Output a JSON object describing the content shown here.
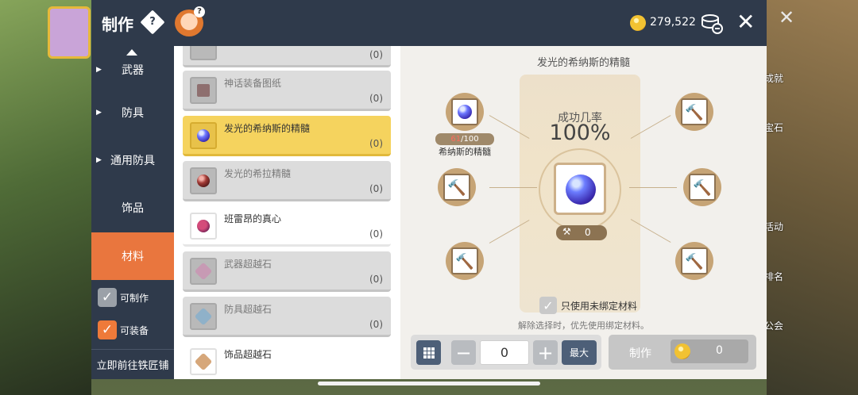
{
  "header": {
    "title": "制作",
    "help_icon": "diamond-question-icon",
    "mascot_icon": "fox-mascot-icon",
    "currency_icon": "meso-coin-icon",
    "currency_amount": "279,522",
    "recipe_icon": "recipe-stack-icon",
    "close_icon": "close-icon"
  },
  "background": {
    "right_labels": [
      "成就",
      "宝石",
      "活动",
      "排名",
      "公会"
    ]
  },
  "nav": {
    "items": [
      {
        "label": "武器",
        "arrow": "▶"
      },
      {
        "label": "防具",
        "arrow": "▶"
      },
      {
        "label": "通用防具",
        "arrow": "▶"
      },
      {
        "label": "饰品",
        "arrow": ""
      },
      {
        "label": "材料",
        "arrow": ""
      }
    ],
    "active_index": 4,
    "filters": [
      {
        "label": "可制作",
        "checked": true,
        "color": "#9ba1a8"
      },
      {
        "label": "可装备",
        "checked": true,
        "color": "#ee7a3a"
      }
    ],
    "goto_label": "立即前往铁匠铺"
  },
  "list": {
    "items": [
      {
        "name": "",
        "count": "(0)"
      },
      {
        "name": "神话装备图纸",
        "count": "(0)"
      },
      {
        "name": "发光的希纳斯的精髓",
        "count": "(0)"
      },
      {
        "name": "发光的希拉精髓",
        "count": "(0)"
      },
      {
        "name": "班雷昂的真心",
        "count": "(0)"
      },
      {
        "name": "武器超越石",
        "count": "(0)"
      },
      {
        "name": "防具超越石",
        "count": "(0)"
      },
      {
        "name": "饰品超越石",
        "count": ""
      }
    ],
    "selected_index": 2
  },
  "craft": {
    "title": "发光的希纳斯的精髓",
    "success_label": "成功几率",
    "success_rate": "100%",
    "craft_count": "0",
    "material": {
      "have": "61",
      "need": "/100",
      "name": "希纳斯的精髓"
    },
    "empty_slot_icon": "hammer-icon",
    "unbound_label": "只使用未绑定材料",
    "unbound_checked": true,
    "unbound_note": "解除选择时，优先使用绑定材料。",
    "quantity": "0",
    "calc_icon": "calculator-icon",
    "minus_label": "−",
    "plus_label": "+",
    "max_label": "最大",
    "craft_button_label": "制作",
    "craft_cost": "0"
  }
}
